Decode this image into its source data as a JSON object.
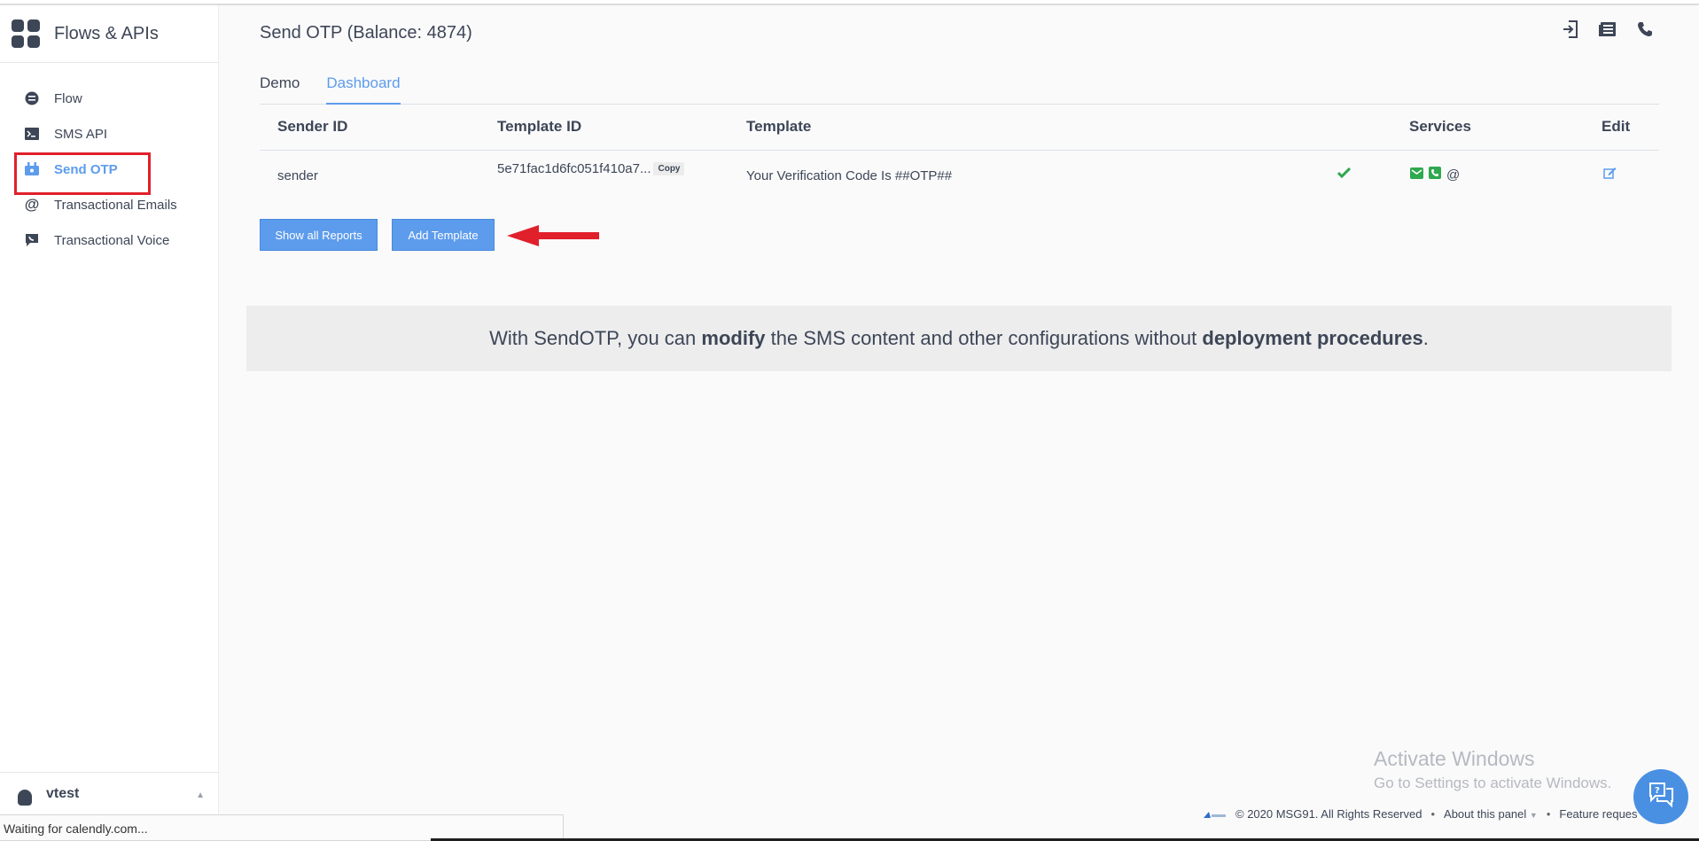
{
  "sidebar": {
    "brand": "Flows & APIs",
    "items": [
      {
        "label": "Flow"
      },
      {
        "label": "SMS API"
      },
      {
        "label": "Send OTP"
      },
      {
        "label": "Transactional Emails"
      },
      {
        "label": "Transactional Voice"
      }
    ],
    "user": "vtest"
  },
  "statusbar": "Waiting for calendly.com...",
  "page": {
    "title": "Send OTP (Balance: 4874)",
    "tabs": [
      {
        "label": "Demo"
      },
      {
        "label": "Dashboard"
      }
    ]
  },
  "table": {
    "headers": [
      "Sender ID",
      "Template ID",
      "Template",
      "Services",
      "Edit"
    ],
    "rows": [
      {
        "sender_id": "sender",
        "template_id": "5e71fac1d6fc051f410a7...",
        "copy_label": "Copy",
        "template": "Your Verification Code Is ##OTP##",
        "service_at": "@"
      }
    ]
  },
  "buttons": {
    "show_reports": "Show all Reports",
    "add_template": "Add Template"
  },
  "info": {
    "p1": "With SendOTP, you can ",
    "b1": "modify",
    "p2": " the SMS content and other configurations without ",
    "b2": "deployment procedures",
    "p3": "."
  },
  "watermark": {
    "line1": "Activate Windows",
    "line2": "Go to Settings to activate Windows."
  },
  "footer": {
    "copyright": "© 2020 MSG91. All Rights Reserved",
    "about": "About this panel",
    "feature": "Feature reques"
  },
  "colors": {
    "accent": "#5d9cec",
    "text": "#3d4656",
    "success": "#2fa84f",
    "highlight": "#e0202b"
  }
}
